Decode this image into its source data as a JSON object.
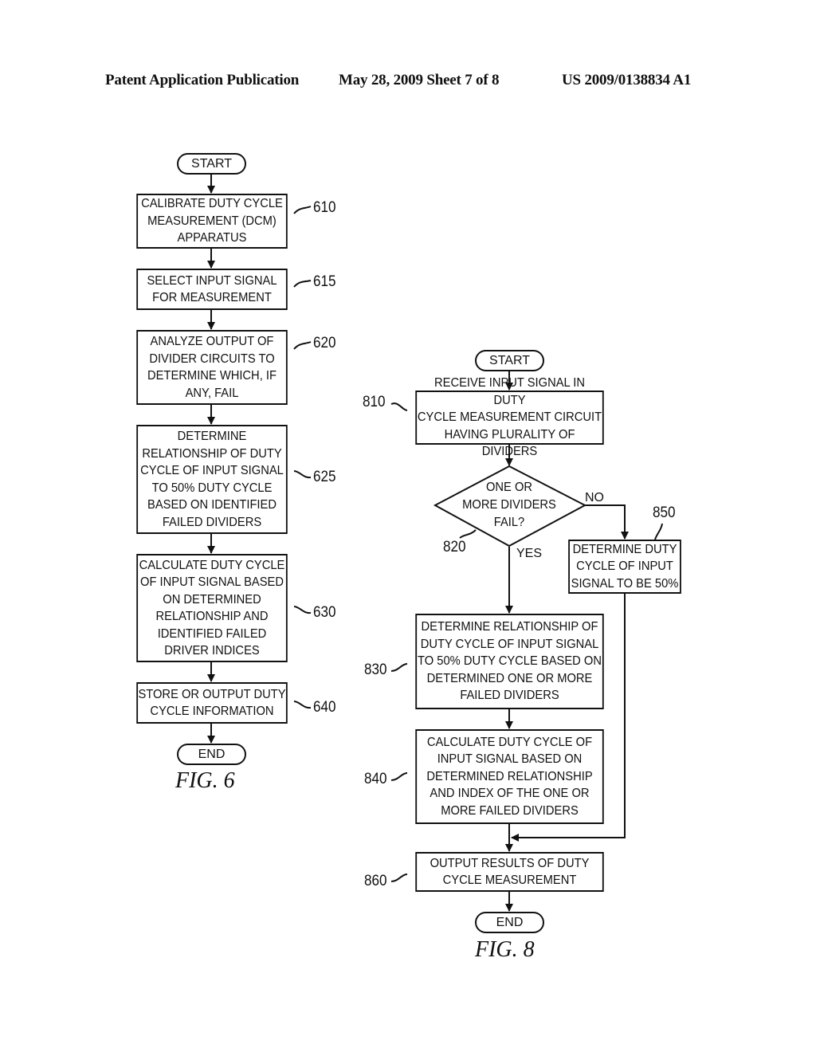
{
  "header": {
    "publication": "Patent Application Publication",
    "date_sheet": "May 28, 2009  Sheet 7 of 8",
    "patent_number": "US 2009/0138834 A1"
  },
  "fig6": {
    "caption": "FIG. 6",
    "start": "START",
    "end": "END",
    "steps": [
      {
        "ref": "610",
        "text": "CALIBRATE DUTY CYCLE\nMEASUREMENT (DCM)\nAPPARATUS"
      },
      {
        "ref": "615",
        "text": "SELECT INPUT SIGNAL\nFOR MEASUREMENT"
      },
      {
        "ref": "620",
        "text": "ANALYZE OUTPUT OF\nDIVIDER CIRCUITS TO\nDETERMINE WHICH, IF\nANY, FAIL"
      },
      {
        "ref": "625",
        "text": "DETERMINE\nRELATIONSHIP OF DUTY\nCYCLE OF INPUT SIGNAL\nTO 50% DUTY CYCLE\nBASED ON IDENTIFIED\nFAILED DIVIDERS"
      },
      {
        "ref": "630",
        "text": "CALCULATE DUTY CYCLE\nOF INPUT SIGNAL BASED\nON DETERMINED\nRELATIONSHIP AND\nIDENTIFIED FAILED\nDRIVER INDICES"
      },
      {
        "ref": "640",
        "text": "STORE OR OUTPUT DUTY\nCYCLE INFORMATION"
      }
    ]
  },
  "fig8": {
    "caption": "FIG. 8",
    "start": "START",
    "end": "END",
    "receive": {
      "ref": "810",
      "text": "RECEIVE INPUT SIGNAL IN DUTY\nCYCLE MEASUREMENT CIRCUIT\nHAVING PLURALITY OF DIVIDERS"
    },
    "decision": {
      "ref": "820",
      "text": "ONE OR\nMORE DIVIDERS\nFAIL?",
      "yes_label": "YES",
      "no_label": "NO"
    },
    "determine_relationship": {
      "ref": "830",
      "text": "DETERMINE RELATIONSHIP OF\nDUTY CYCLE OF INPUT SIGNAL\nTO 50% DUTY CYCLE BASED ON\nDETERMINED ONE OR MORE\nFAILED DIVIDERS"
    },
    "calculate": {
      "ref": "840",
      "text": "CALCULATE DUTY CYCLE OF\nINPUT SIGNAL BASED ON\nDETERMINED RELATIONSHIP\nAND INDEX OF THE ONE OR\nMORE FAILED DIVIDERS"
    },
    "default_50": {
      "ref": "850",
      "text": "DETERMINE DUTY\nCYCLE OF INPUT\nSIGNAL TO BE 50%"
    },
    "output": {
      "ref": "860",
      "text": "OUTPUT RESULTS OF DUTY\nCYCLE MEASUREMENT"
    }
  }
}
